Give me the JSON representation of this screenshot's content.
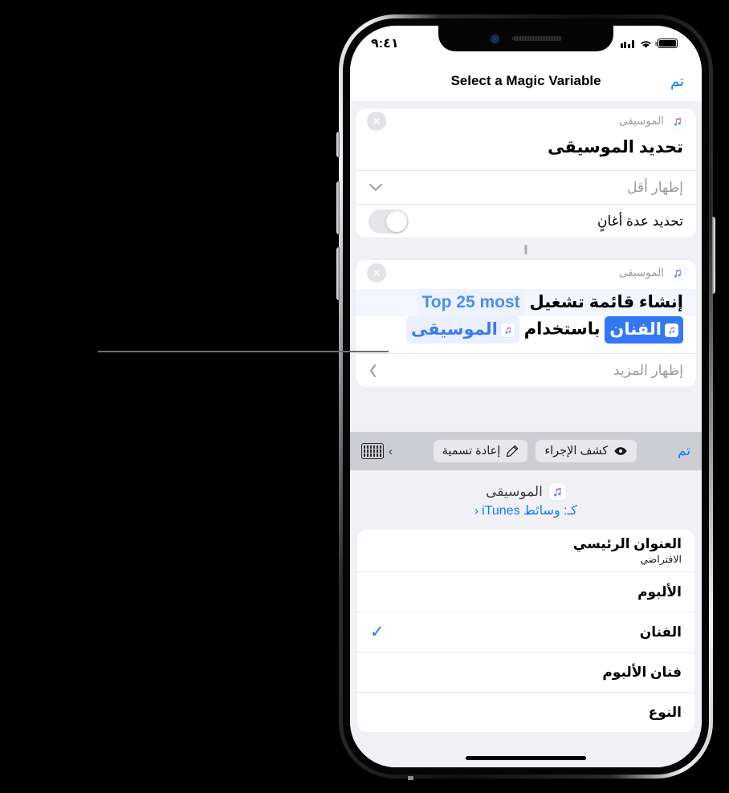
{
  "status_bar": {
    "time": "٩:٤١",
    "battery_icon": "battery-full-icon",
    "wifi_icon": "wifi-icon",
    "cellular_icon": "cellular-signal-icon"
  },
  "nav_bar": {
    "done_label": "تم",
    "title": "Select a Magic Variable"
  },
  "cards": [
    {
      "app_name": "الموسيقى",
      "app_icon": "apple-music-icon",
      "close_icon": "close-circle-icon",
      "title": "تحديد الموسيقى",
      "rows": [
        {
          "label": "إظهار أقل",
          "control": "chevron-down-icon",
          "glyph": "⌄"
        },
        {
          "label": "تحديد عدة أغانٍ",
          "control": "toggle-off"
        }
      ]
    },
    {
      "app_name": "الموسيقى",
      "app_icon": "apple-music-icon",
      "close_icon": "close-circle-icon",
      "sentence": {
        "part1": "إنشاء قائمة تشغيل",
        "token_playlist": "Top 25 most",
        "part2": "باستخدام",
        "token_artist": "الفنان",
        "token_music": "الموسيقى"
      },
      "rows": [
        {
          "label": "إظهار المزيد",
          "control": "chevron-left-icon",
          "glyph": "‹"
        }
      ]
    }
  ],
  "toolbar": {
    "done_label": "تم",
    "reveal_action_label": "كشف الإجراء",
    "reveal_action_icon": "eye-icon",
    "rename_label": "إعادة تسمية",
    "rename_icon": "pencil-icon",
    "keyboard_icon": "keyboard-icon",
    "keyboard_chevron": "›"
  },
  "picker": {
    "source_name": "الموسيقى",
    "source_icon": "apple-music-icon",
    "subtitle": "كـ: وسائط iTunes",
    "subtitle_chevron": "‹",
    "items": [
      {
        "title": "العنوان الرئيسي",
        "subtitle": "الافتراضي",
        "checked": false
      },
      {
        "title": "الألبوم",
        "subtitle": "",
        "checked": false
      },
      {
        "title": "الفنان",
        "subtitle": "",
        "checked": true
      },
      {
        "title": "فنان الألبوم",
        "subtitle": "",
        "checked": false
      },
      {
        "title": "النوع",
        "subtitle": "",
        "checked": false
      }
    ],
    "check_glyph": "✓"
  },
  "colors": {
    "accent_blue": "#0a7cff",
    "token_blue": "#3478f6",
    "panel_bg": "#f1f1f5",
    "toolbar_bg": "#cdcdd4"
  }
}
